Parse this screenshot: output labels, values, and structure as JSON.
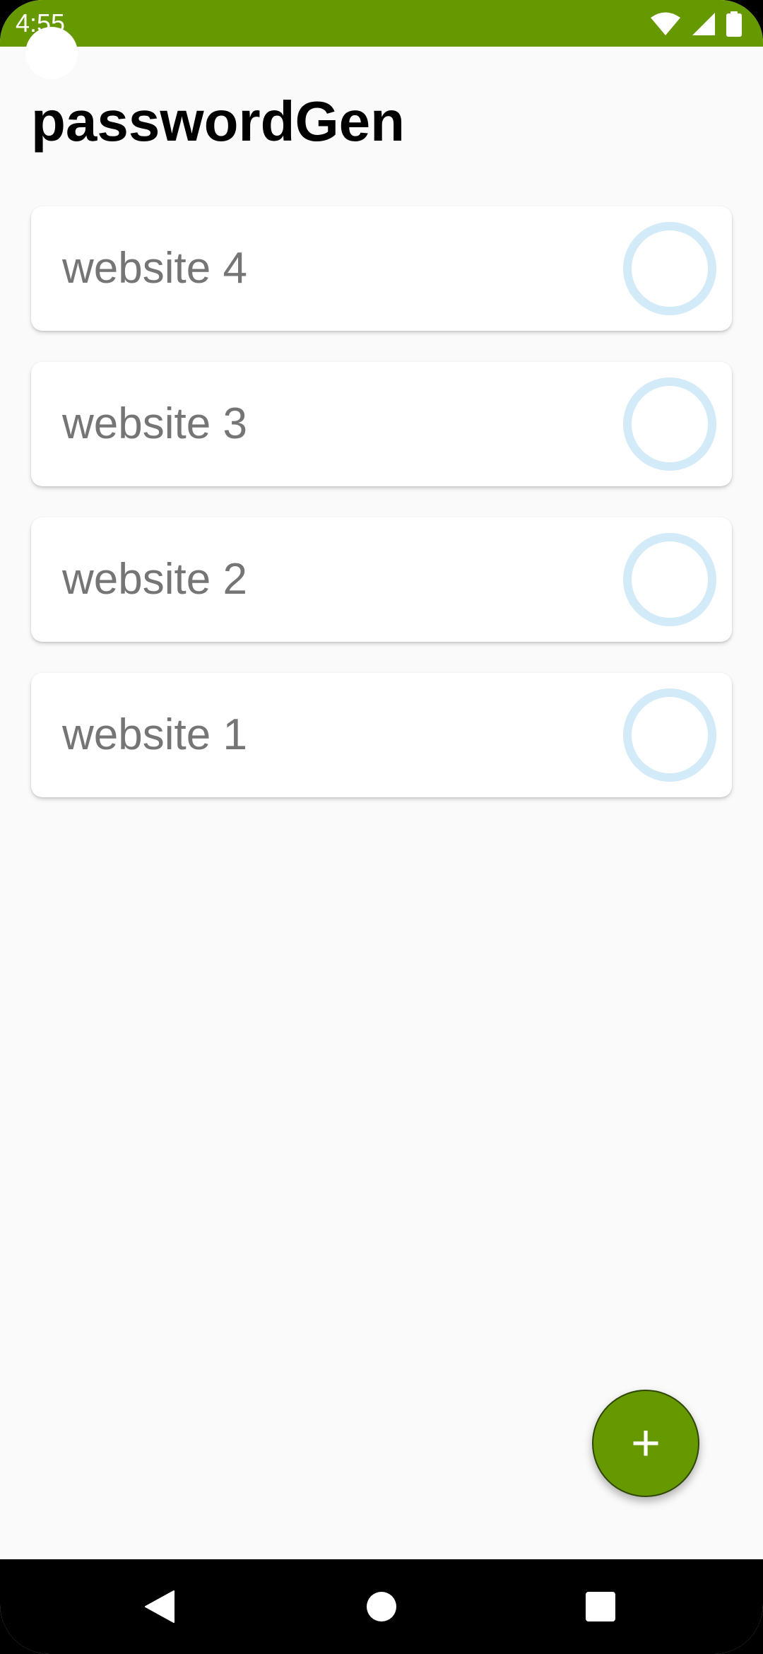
{
  "status_bar": {
    "time": "4:55",
    "color": "#669900",
    "icons": [
      "wifi-icon",
      "signal-icon",
      "battery-icon"
    ]
  },
  "app": {
    "title": "passwordGen"
  },
  "websites": [
    {
      "label": "website 4"
    },
    {
      "label": "website 3"
    },
    {
      "label": "website 2"
    },
    {
      "label": "website 1"
    }
  ],
  "fab": {
    "label": "+",
    "color": "#669900"
  },
  "nav_bar": {
    "buttons": [
      "back-icon",
      "home-icon",
      "recents-icon"
    ]
  }
}
